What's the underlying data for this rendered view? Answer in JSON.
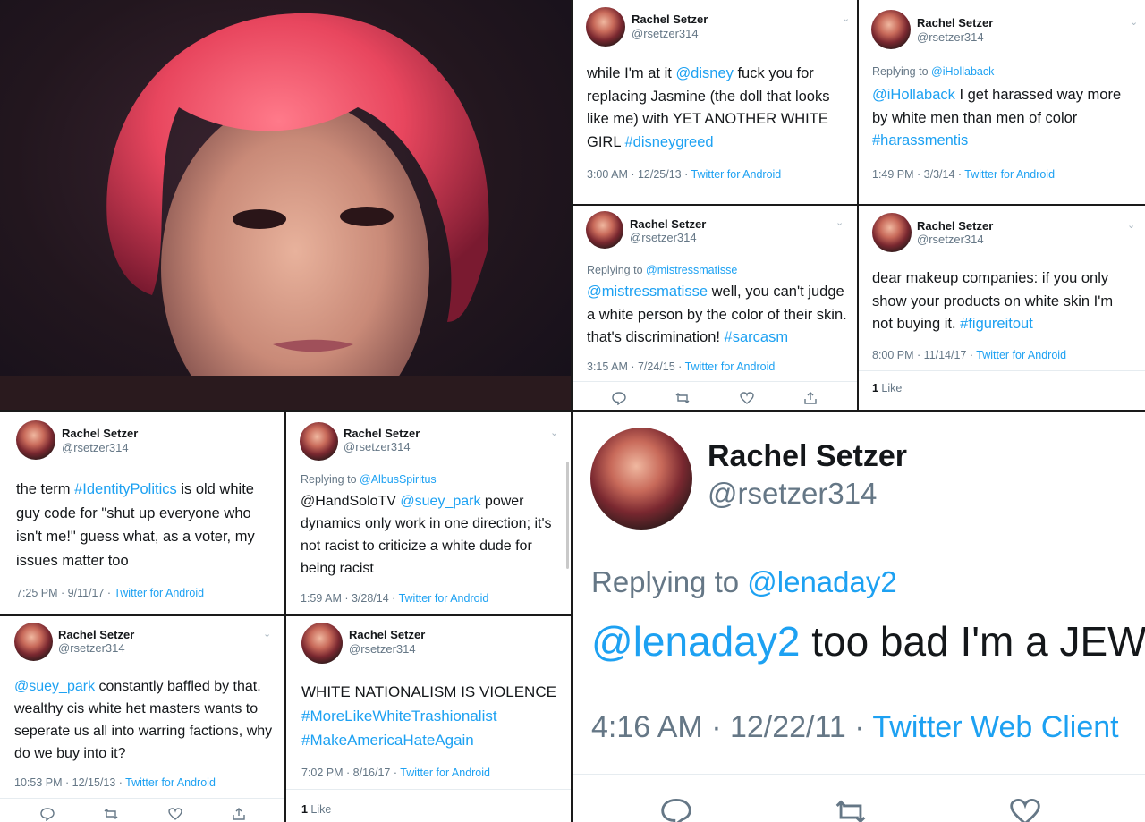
{
  "tweets": [
    {
      "id": "t1",
      "name": "Rachel Setzer",
      "handle": "@rsetzer314",
      "lines": [
        [
          {
            "t": "while I'm at it "
          },
          {
            "t": "@disney",
            "link": true
          },
          {
            "t": " fuck you for"
          }
        ],
        [
          {
            "t": "replacing Jasmine (the doll that looks"
          }
        ],
        [
          {
            "t": "like me) with YET ANOTHER WHITE"
          }
        ],
        [
          {
            "t": "GIRL "
          },
          {
            "t": "#disneygreed",
            "link": true
          }
        ]
      ],
      "time": "3:00 AM · 12/25/13 · ",
      "source": "Twitter for Android"
    },
    {
      "id": "t2",
      "name": "Rachel Setzer",
      "handle": "@rsetzer314",
      "replying_label": "Replying to ",
      "replying_to": "@iHollaback",
      "lines": [
        [
          {
            "t": "@iHollaback",
            "link": true
          },
          {
            "t": " I get harassed way more"
          }
        ],
        [
          {
            "t": "by white men than men of color"
          }
        ],
        [
          {
            "t": "#harassmentis",
            "link": true
          }
        ]
      ],
      "time": "1:49 PM · 3/3/14 · ",
      "source": "Twitter for Android"
    },
    {
      "id": "t3",
      "name": "Rachel Setzer",
      "handle": "@rsetzer314",
      "replying_label": "Replying to ",
      "replying_to": "@mistressmatisse",
      "lines": [
        [
          {
            "t": "@mistressmatisse",
            "link": true
          },
          {
            "t": " well, you can't judge"
          }
        ],
        [
          {
            "t": "a white person by the color of their skin."
          }
        ],
        [
          {
            "t": "that's discrimination! "
          },
          {
            "t": "#sarcasm",
            "link": true
          }
        ]
      ],
      "time": "3:15 AM · 7/24/15 · ",
      "source": "Twitter for Android"
    },
    {
      "id": "t4",
      "name": "Rachel Setzer",
      "handle": "@rsetzer314",
      "lines": [
        [
          {
            "t": "dear makeup companies: if you only"
          }
        ],
        [
          {
            "t": "show your products on white skin I'm"
          }
        ],
        [
          {
            "t": "not buying it. "
          },
          {
            "t": "#figureitout",
            "link": true
          }
        ]
      ],
      "time": "8:00 PM · 11/14/17 · ",
      "source": "Twitter for Android",
      "likes_count": "1",
      "likes_label": " Like"
    },
    {
      "id": "t5",
      "name": "Rachel Setzer",
      "handle": "@rsetzer314",
      "lines": [
        [
          {
            "t": "the term "
          },
          {
            "t": "#IdentityPolitics",
            "link": true
          },
          {
            "t": " is old white"
          }
        ],
        [
          {
            "t": "guy code for \"shut up everyone who"
          }
        ],
        [
          {
            "t": "isn't me!\" guess what, as a voter, my"
          }
        ],
        [
          {
            "t": "issues matter too"
          }
        ]
      ],
      "time": "7:25 PM · 9/11/17 · ",
      "source": "Twitter for Android"
    },
    {
      "id": "t6",
      "name": "Rachel Setzer",
      "handle": "@rsetzer314",
      "replying_label": "Replying to ",
      "replying_to": "@AlbusSpiritus",
      "lines": [
        [
          {
            "t": "@HandSoloTV "
          },
          {
            "t": "@suey_park",
            "link": true
          },
          {
            "t": " power"
          }
        ],
        [
          {
            "t": "dynamics only work in one direction; it's"
          }
        ],
        [
          {
            "t": "not racist to criticize a white dude for"
          }
        ],
        [
          {
            "t": "being racist"
          }
        ]
      ],
      "time": "1:59 AM · 3/28/14 · ",
      "source": "Twitter for Android"
    },
    {
      "id": "t7",
      "name": "Rachel Setzer",
      "handle": "@rsetzer314",
      "lines": [
        [
          {
            "t": "@suey_park",
            "link": true
          },
          {
            "t": " constantly baffled by that."
          }
        ],
        [
          {
            "t": "wealthy cis white het masters wants to"
          }
        ],
        [
          {
            "t": "seperate us all into warring factions, why"
          }
        ],
        [
          {
            "t": "do we buy into it?"
          }
        ]
      ],
      "time": "10:53 PM · 12/15/13 · ",
      "source": "Twitter for Android"
    },
    {
      "id": "t8",
      "name": "Rachel Setzer",
      "handle": "@rsetzer314",
      "lines": [
        [
          {
            "t": "WHITE NATIONALISM IS VIOLENCE"
          }
        ],
        [
          {
            "t": "#MoreLikeWhiteTrashionalist",
            "link": true
          }
        ],
        [
          {
            "t": "#MakeAmericaHateAgain",
            "link": true
          }
        ]
      ],
      "time": "7:02 PM · 8/16/17 · ",
      "source": "Twitter for Android",
      "likes_count": "1",
      "likes_label": " Like"
    },
    {
      "id": "t9",
      "name": "Rachel Setzer",
      "handle": "@rsetzer314",
      "replying_label": "Replying to ",
      "replying_to": "@lenaday2",
      "lines": [
        [
          {
            "t": "@lenaday2",
            "link": true
          },
          {
            "t": " too bad I'm a JEW"
          }
        ]
      ],
      "time": "4:16 AM · 12/22/11 · ",
      "source": "Twitter Web Client"
    }
  ],
  "icons": {
    "reply": "reply-icon",
    "retweet": "retweet-icon",
    "like": "heart-icon",
    "share": "share-icon",
    "chevron": "chevron-down-icon"
  },
  "colors": {
    "link": "#1da1f2",
    "secondary": "#657786",
    "text": "#14171a"
  }
}
